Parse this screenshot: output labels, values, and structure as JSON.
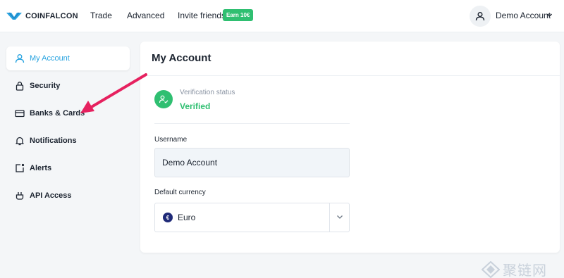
{
  "brand": {
    "name": "COINFALCON",
    "accent": "#2aa4e0",
    "success": "#2fbf71"
  },
  "topnav": {
    "links": [
      "Trade",
      "Advanced",
      "Invite friends"
    ],
    "invite_badge": "Earn 10€",
    "account_name": "Demo Account"
  },
  "sidebar": {
    "items": [
      {
        "label": "My Account",
        "icon": "user-icon",
        "active": true
      },
      {
        "label": "Security",
        "icon": "lock-icon",
        "active": false
      },
      {
        "label": "Banks & Cards",
        "icon": "card-icon",
        "active": false
      },
      {
        "label": "Notifications",
        "icon": "bell-icon",
        "active": false
      },
      {
        "label": "Alerts",
        "icon": "alert-icon",
        "active": false
      },
      {
        "label": "API Access",
        "icon": "plug-icon",
        "active": false
      }
    ]
  },
  "main": {
    "title": "My Account",
    "verification": {
      "label": "Verification status",
      "value": "Verified"
    },
    "username": {
      "label": "Username",
      "value": "Demo Account"
    },
    "currency": {
      "label": "Default currency",
      "value": "Euro",
      "symbol": "€"
    }
  },
  "watermark": "聚链网"
}
